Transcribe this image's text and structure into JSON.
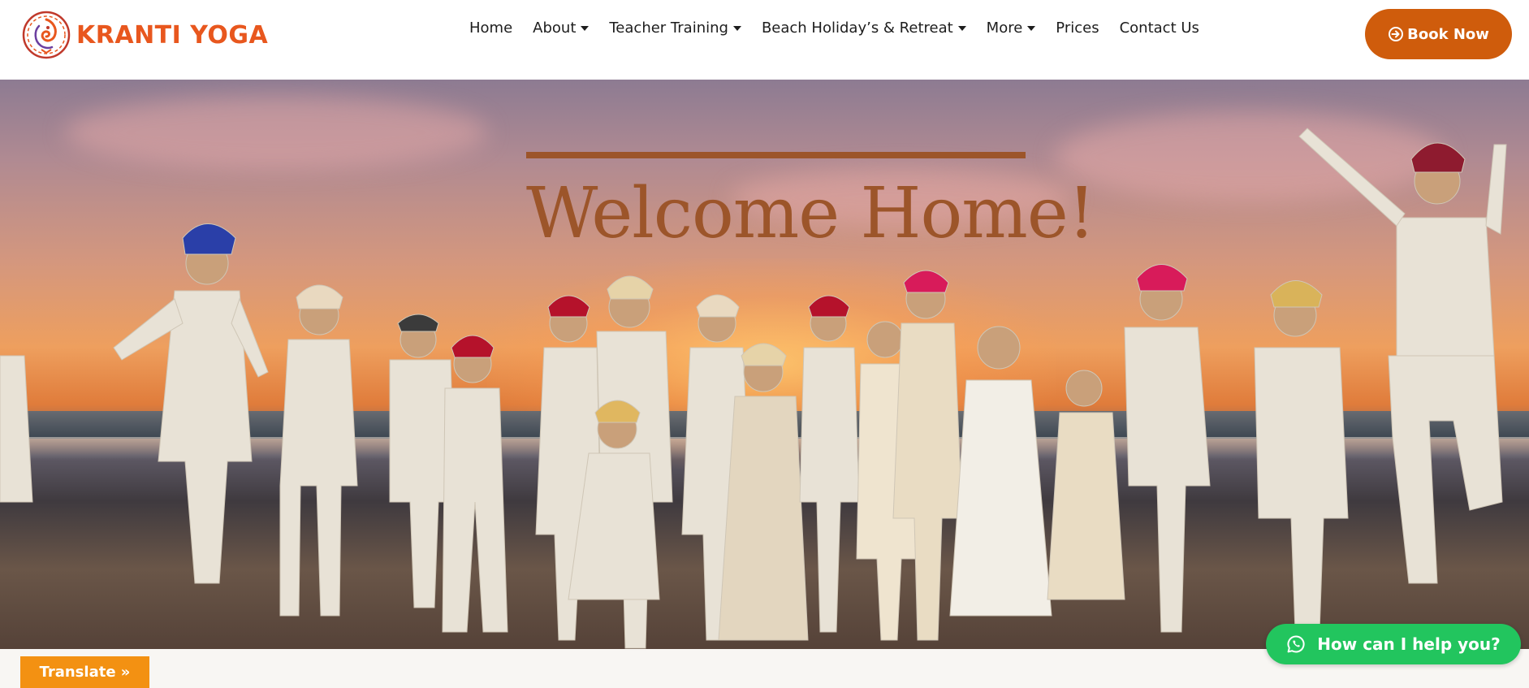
{
  "header": {
    "logo_text": "KRANTI YOGA",
    "nav": [
      {
        "label": "Home",
        "has_dropdown": false
      },
      {
        "label": "About",
        "has_dropdown": true
      },
      {
        "label": "Teacher Training",
        "has_dropdown": true
      },
      {
        "label": "Beach Holiday’s & Retreat",
        "has_dropdown": true
      },
      {
        "label": "More",
        "has_dropdown": true
      },
      {
        "label": "Prices",
        "has_dropdown": false
      },
      {
        "label": "Contact Us",
        "has_dropdown": false
      }
    ],
    "book_button": {
      "label": "Book Now",
      "icon": "arrow-circle-right-icon"
    }
  },
  "hero": {
    "title": "Welcome Home!",
    "image": "group of people in white clothes and turbans jumping on a beach at sunset"
  },
  "widgets": {
    "translate_label": "Translate »",
    "whatsapp_label": "How can I help you?",
    "whatsapp_icon": "whatsapp-icon"
  },
  "colors": {
    "brand_orange": "#e8571e",
    "book_button": "#cf5c0c",
    "hero_title": "#9c552a",
    "translate_button": "#f39112",
    "whatsapp_button": "#22c55e"
  }
}
